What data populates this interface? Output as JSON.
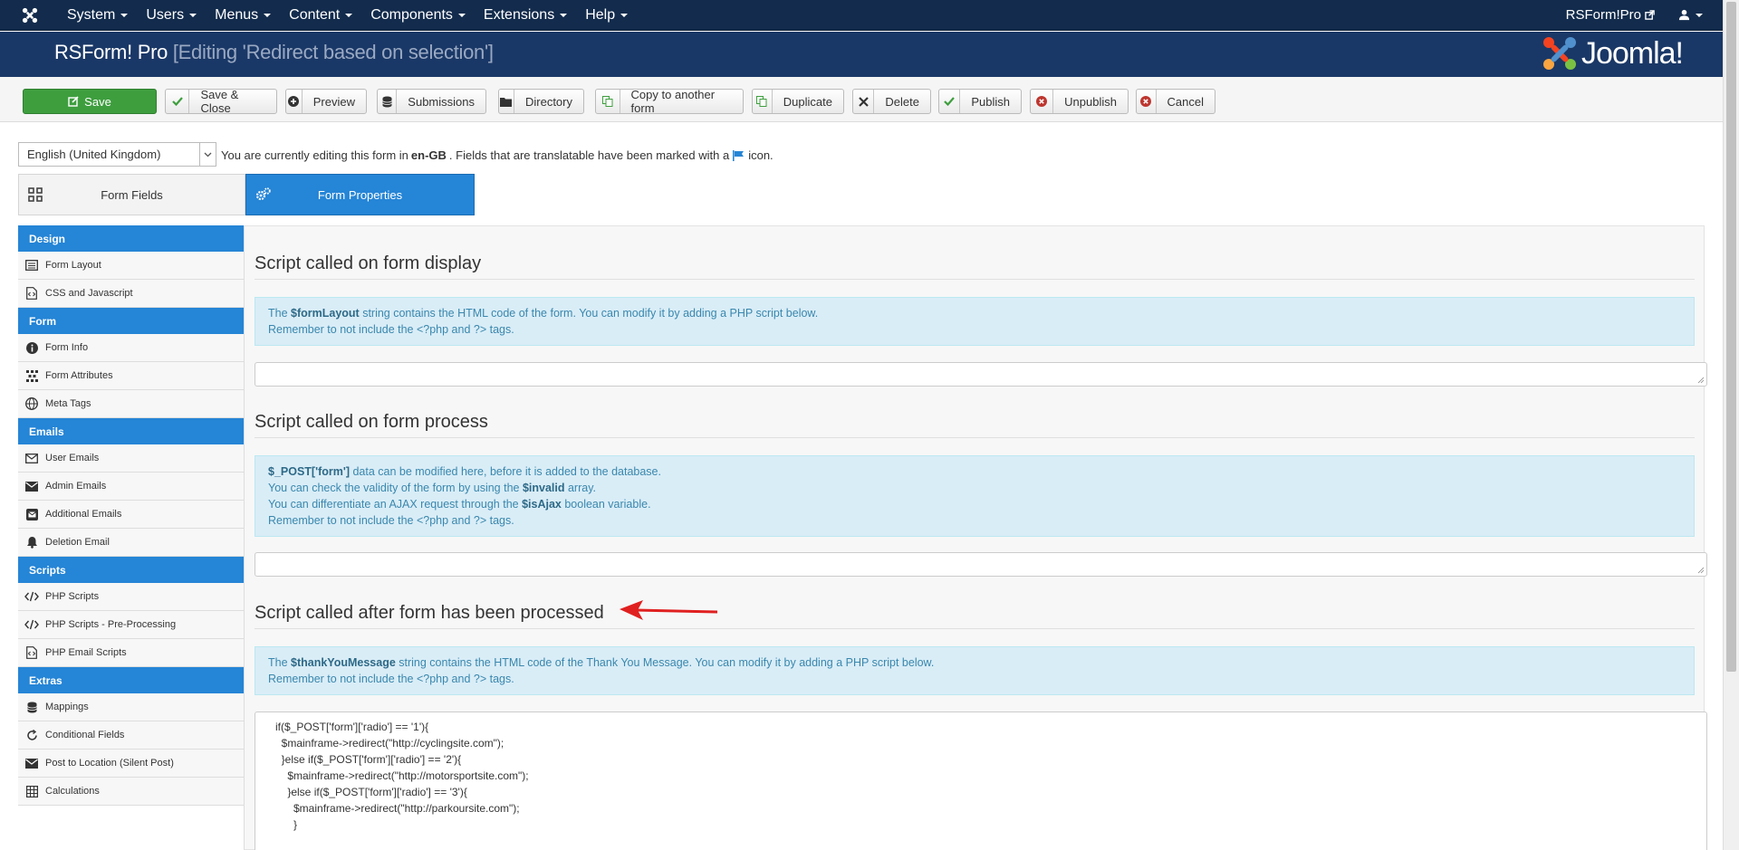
{
  "topnav": {
    "menu": [
      "System",
      "Users",
      "Menus",
      "Content",
      "Components",
      "Extensions",
      "Help"
    ],
    "site_link": "RSForm!Pro"
  },
  "header": {
    "title": "RSForm! Pro",
    "subtitle": "[Editing 'Redirect based on selection']",
    "brand": "Joomla!"
  },
  "toolbar": {
    "save": "Save",
    "save_close": "Save & Close",
    "preview": "Preview",
    "submissions": "Submissions",
    "directory": "Directory",
    "copy": "Copy to another form",
    "duplicate": "Duplicate",
    "delete": "Delete",
    "publish": "Publish",
    "unpublish": "Unpublish",
    "cancel": "Cancel"
  },
  "language": {
    "selected": "English (United Kingdom)",
    "note_before": "You are currently editing this form in",
    "code": "en-GB",
    "note_after": ". Fields that are translatable have been marked with a",
    "note_end": "icon."
  },
  "tabs": {
    "fields": "Form Fields",
    "properties": "Form Properties"
  },
  "sidebar": {
    "design": "Design",
    "form_layout": "Form Layout",
    "css_js": "CSS and Javascript",
    "form": "Form",
    "form_info": "Form Info",
    "form_attributes": "Form Attributes",
    "meta_tags": "Meta Tags",
    "emails": "Emails",
    "user_emails": "User Emails",
    "admin_emails": "Admin Emails",
    "additional_emails": "Additional Emails",
    "deletion_email": "Deletion Email",
    "scripts": "Scripts",
    "php_scripts": "PHP Scripts",
    "php_pre": "PHP Scripts - Pre-Processing",
    "php_email": "PHP Email Scripts",
    "extras": "Extras",
    "mappings": "Mappings",
    "conditional": "Conditional Fields",
    "post_location": "Post to Location (Silent Post)",
    "calculations": "Calculations"
  },
  "content": {
    "display_title": "Script called on form display",
    "display_b1": "$formLayout",
    "display_t1": " string contains the HTML code of the form. You can modify it by adding a PHP script below.",
    "display_t2": "Remember to not include the <?php and ?> tags.",
    "process_title": "Script called on form process",
    "process_b1": "$_POST['form']",
    "process_t1": " data can be modified here, before it is added to the database.",
    "process_t2a": "You can check the validity of the form by using the ",
    "process_b2": "$invalid",
    "process_t2b": " array.",
    "process_t3a": "You can differentiate an AJAX request through the ",
    "process_b3": "$isAjax",
    "process_t3b": " boolean variable.",
    "process_t4": "Remember to not include the <?php and ?> tags.",
    "after_title": "Script called after form has been processed",
    "after_b1": "$thankYouMessage",
    "after_t1": " string contains the HTML code of the Thank You Message. You can modify it by adding a PHP script below.",
    "after_t2": "Remember to not include the <?php and ?> tags.",
    "after_code": "if($_POST['form']['radio'] == '1'){\n  $mainframe->redirect(\"http://cyclingsite.com\");\n  }else if($_POST['form']['radio'] == '2'){\n    $mainframe->redirect(\"http://motorsportsite.com\");\n    }else if($_POST['form']['radio'] == '3'){\n      $mainframe->redirect(\"http://parkoursite.com\");\n      }"
  },
  "colors": {
    "nav": "#132c4d",
    "header": "#1a3867",
    "accent": "#2585d6",
    "save": "#3e9e3e",
    "alert_bg": "#d9edf7",
    "arrow": "#e02020"
  }
}
